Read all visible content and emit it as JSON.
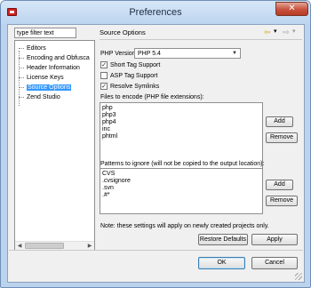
{
  "window": {
    "title": "Preferences",
    "close_glyph": "✕"
  },
  "filter": {
    "value": "type filter text"
  },
  "tree": {
    "items": [
      {
        "label": "Editors"
      },
      {
        "label": "Encoding and Obfusca"
      },
      {
        "label": "Header Information"
      },
      {
        "label": "License Keys"
      },
      {
        "label": "Source Options",
        "selected": true
      },
      {
        "label": "Zend Studio"
      }
    ]
  },
  "page": {
    "title": "Source Options",
    "nav": {
      "back": "⇦",
      "back_menu": "▾",
      "forward": "⇨",
      "forward_menu": "▾"
    }
  },
  "php_version": {
    "label": "PHP Version:",
    "value": "PHP 5.4"
  },
  "checkboxes": [
    {
      "label": "Short Tag Support",
      "checked": true
    },
    {
      "label": "ASP Tag Support",
      "checked": false
    },
    {
      "label": "Resolve Symlinks",
      "checked": true
    }
  ],
  "files_to_encode": {
    "label": "Files to encode (PHP file extensions):",
    "items": [
      "php",
      "php3",
      "php4",
      "inc",
      "phtml"
    ],
    "add_label": "Add",
    "remove_label": "Remove"
  },
  "patterns": {
    "label": "Patterns to ignore (will not be copied to the output location):",
    "items": [
      "CVS",
      ".cvsignore",
      ".svn",
      ".#*"
    ],
    "add_label": "Add",
    "remove_label": "Remove"
  },
  "note": "Note: these settings will apply on newly created projects only.",
  "buttons": {
    "restore_defaults": "Restore Defaults",
    "apply": "Apply",
    "ok": "OK",
    "cancel": "Cancel"
  },
  "icons": {
    "app": "zend-app-icon",
    "nav_back": "back-arrow-icon",
    "nav_forward": "forward-arrow-icon",
    "checkmark": "✓"
  },
  "colors": {
    "selection": "#3399ff",
    "titlebar": "#bdd5f0",
    "close": "#c7513c"
  }
}
